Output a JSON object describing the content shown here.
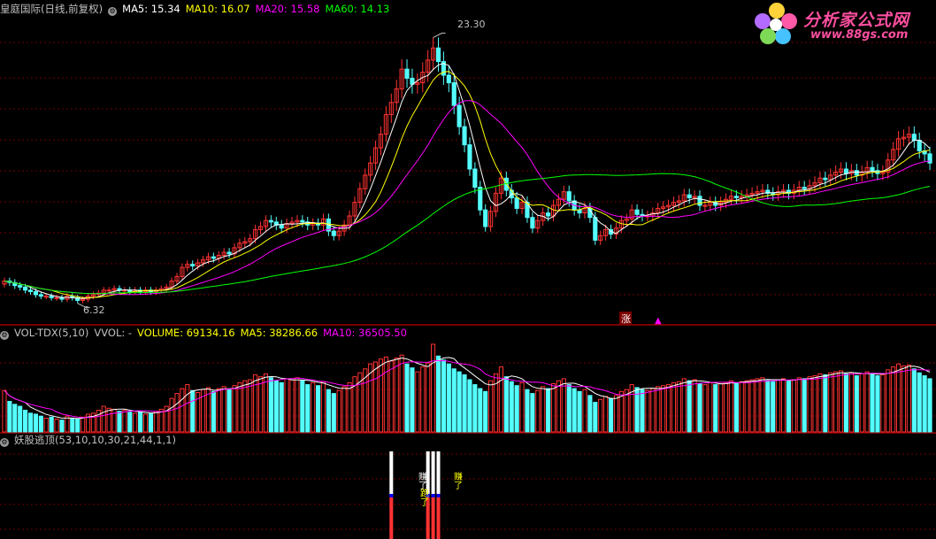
{
  "colors": {
    "up": "#ff3232",
    "down": "#54ffff",
    "ma5": "#ffffff",
    "ma10": "#ffff00",
    "ma20": "#ff00ff",
    "ma60": "#00ff00",
    "grid": "#6b0000",
    "sep": "#a00000",
    "label": "#c0c0c0"
  },
  "price_panel": {
    "title": "皇庭国际(日线,前复权)",
    "ma5_label": "MA5: 15.34",
    "ma10_label": "MA10: 16.07",
    "ma20_label": "MA20: 15.58",
    "ma60_label": "MA60: 14.13",
    "high_label": "23.30",
    "low_label": "6.32",
    "marker_zhang": "涨",
    "gear_icon": "gear-icon"
  },
  "volume_panel": {
    "title": "VOL-TDX(5,10)",
    "vvol_label": "VVOL: -",
    "volume_label": "VOLUME: 69134.16",
    "ma5_label": "MA5: 38286.66",
    "ma10_label": "MA10: 36505.50"
  },
  "signal_panel": {
    "title": "妖股逃顶(53,10,10,30,21,44,1,1)",
    "signal_text": "赚了",
    "signal_text_b": "跑了"
  },
  "logo": {
    "title": "分析家公式网",
    "url": "www.88gs.com"
  },
  "chart_data": [
    {
      "type": "candlestick",
      "title": "皇庭国际(日线,前复权)",
      "annotations": [
        {
          "label": "23.30",
          "kind": "max"
        },
        {
          "label": "6.32",
          "kind": "min"
        }
      ],
      "ylim": [
        5.0,
        25.0
      ],
      "close": [
        7.6,
        7.5,
        7.3,
        7.2,
        7.0,
        6.9,
        6.7,
        6.6,
        6.6,
        6.5,
        6.5,
        6.4,
        6.6,
        6.5,
        6.32,
        6.4,
        6.6,
        6.7,
        6.8,
        7.0,
        7.0,
        7.1,
        7.0,
        7.0,
        6.9,
        7.0,
        6.9,
        7.0,
        6.9,
        7.0,
        7.1,
        7.2,
        7.6,
        7.9,
        8.5,
        8.7,
        8.6,
        8.8,
        9.0,
        9.2,
        9.1,
        9.3,
        9.5,
        9.4,
        9.8,
        10.1,
        10.2,
        10.4,
        11.0,
        11.2,
        11.6,
        11.5,
        11.3,
        11.1,
        11.4,
        11.5,
        11.6,
        11.5,
        11.3,
        11.4,
        11.3,
        11.7,
        10.9,
        10.6,
        10.9,
        11.3,
        11.9,
        12.8,
        13.7,
        14.6,
        15.4,
        16.4,
        17.3,
        18.6,
        19.4,
        20.3,
        21.6,
        21.0,
        20.6,
        20.7,
        21.4,
        22.2,
        23.0,
        22.1,
        21.2,
        20.7,
        19.2,
        17.8,
        16.6,
        15.0,
        13.8,
        12.3,
        11.2,
        12.2,
        13.4,
        14.4,
        13.6,
        13.1,
        12.4,
        12.8,
        11.8,
        11.1,
        11.6,
        12.1,
        11.9,
        12.6,
        13.0,
        13.5,
        12.9,
        12.3,
        12.1,
        12.4,
        11.8,
        10.3,
        10.6,
        11.0,
        10.7,
        11.1,
        11.6,
        11.7,
        12.3,
        12.0,
        11.9,
        11.9,
        12.1,
        12.4,
        12.5,
        12.6,
        12.8,
        12.9,
        13.3,
        13.1,
        13.2,
        12.6,
        12.6,
        12.8,
        12.6,
        12.8,
        13.0,
        13.2,
        13.1,
        13.2,
        13.3,
        13.4,
        13.5,
        13.6,
        13.4,
        13.3,
        13.5,
        13.6,
        13.4,
        13.6,
        13.8,
        13.7,
        13.9,
        14.1,
        14.4,
        14.3,
        14.6,
        14.8,
        15.0,
        14.7,
        14.9,
        14.6,
        14.8,
        15.1,
        14.9,
        14.7,
        14.8,
        15.6,
        16.3,
        17.0,
        17.1,
        17.3,
        16.9,
        16.2,
        16.0,
        15.4
      ],
      "open": [
        7.4,
        7.6,
        7.5,
        7.3,
        7.2,
        7.0,
        6.9,
        6.7,
        6.6,
        6.6,
        6.5,
        6.5,
        6.4,
        6.6,
        6.5,
        6.32,
        6.4,
        6.6,
        6.7,
        6.8,
        7.0,
        7.0,
        7.1,
        7.0,
        7.0,
        6.9,
        7.0,
        6.9,
        7.0,
        6.9,
        7.0,
        7.1,
        7.2,
        7.6,
        7.9,
        8.5,
        8.7,
        8.6,
        8.8,
        9.0,
        9.2,
        9.1,
        9.3,
        9.5,
        9.4,
        9.8,
        10.1,
        10.2,
        10.4,
        11.0,
        11.2,
        11.6,
        11.5,
        11.3,
        11.1,
        11.4,
        11.5,
        11.6,
        11.5,
        11.3,
        11.4,
        11.3,
        11.7,
        10.9,
        10.6,
        10.9,
        11.3,
        11.9,
        12.8,
        13.7,
        14.6,
        15.4,
        16.4,
        17.3,
        18.6,
        19.4,
        20.3,
        21.6,
        21.0,
        20.6,
        20.7,
        21.4,
        22.2,
        23.0,
        22.1,
        21.2,
        20.7,
        19.2,
        17.8,
        16.6,
        15.0,
        13.8,
        12.3,
        11.2,
        12.2,
        13.4,
        14.4,
        13.6,
        13.1,
        12.4,
        12.8,
        11.8,
        11.1,
        11.6,
        12.1,
        11.9,
        12.6,
        13.0,
        13.5,
        12.9,
        12.3,
        12.1,
        12.4,
        11.8,
        10.3,
        10.6,
        11.0,
        10.7,
        11.1,
        11.6,
        11.7,
        12.3,
        12.0,
        11.9,
        11.9,
        12.1,
        12.4,
        12.5,
        12.6,
        12.8,
        12.9,
        13.3,
        13.1,
        13.2,
        12.6,
        12.6,
        12.8,
        12.6,
        12.8,
        13.0,
        13.2,
        13.1,
        13.2,
        13.3,
        13.4,
        13.5,
        13.6,
        13.4,
        13.3,
        13.5,
        13.6,
        13.4,
        13.6,
        13.8,
        13.7,
        13.9,
        14.1,
        14.4,
        14.3,
        14.6,
        14.8,
        15.0,
        14.7,
        14.9,
        14.6,
        14.8,
        15.1,
        14.9,
        14.7,
        14.8,
        15.6,
        16.3,
        17.0,
        17.1,
        17.3,
        16.9,
        16.2,
        16.0
      ]
    },
    {
      "type": "bar",
      "title": "VOL-TDX(5,10)",
      "values": [
        4.2,
        3.1,
        2.8,
        2.6,
        2.2,
        1.9,
        1.8,
        1.6,
        1.4,
        1.5,
        1.3,
        1.2,
        1.6,
        1.4,
        1.3,
        1.5,
        1.8,
        1.9,
        2.2,
        2.6,
        2.4,
        2.3,
        2.1,
        2.2,
        2.0,
        1.9,
        2.0,
        1.8,
        1.9,
        2.1,
        2.3,
        2.6,
        3.4,
        3.9,
        4.4,
        4.8,
        4.2,
        4.0,
        4.3,
        4.5,
        4.1,
        4.4,
        4.6,
        4.3,
        4.7,
        5.0,
        5.2,
        5.3,
        5.8,
        5.6,
        5.9,
        5.5,
        5.2,
        5.0,
        5.4,
        5.3,
        5.5,
        5.2,
        4.8,
        5.0,
        4.7,
        5.1,
        4.3,
        3.9,
        4.2,
        4.6,
        5.0,
        5.6,
        6.0,
        6.4,
        6.9,
        7.1,
        7.4,
        7.6,
        7.2,
        7.5,
        7.8,
        6.9,
        6.5,
        6.1,
        6.6,
        7.0,
        8.9,
        7.7,
        7.3,
        6.9,
        6.4,
        6.1,
        5.8,
        5.3,
        4.8,
        4.4,
        4.1,
        5.2,
        5.9,
        6.6,
        5.6,
        5.1,
        4.7,
        5.0,
        4.3,
        3.9,
        4.2,
        4.6,
        4.4,
        4.9,
        5.2,
        5.4,
        4.8,
        4.4,
        4.1,
        4.3,
        3.7,
        3.0,
        3.3,
        3.6,
        3.4,
        3.7,
        4.1,
        4.3,
        4.8,
        4.5,
        4.3,
        4.2,
        4.4,
        4.6,
        4.7,
        4.8,
        5.0,
        5.1,
        5.4,
        5.2,
        5.3,
        4.9,
        4.8,
        5.0,
        4.8,
        4.9,
        5.0,
        5.2,
        5.0,
        5.1,
        5.2,
        5.3,
        5.4,
        5.5,
        5.2,
        5.1,
        5.3,
        5.4,
        5.2,
        5.3,
        5.5,
        5.4,
        5.6,
        5.7,
        5.9,
        5.8,
        6.0,
        6.1,
        6.2,
        5.9,
        6.0,
        5.7,
        5.9,
        6.1,
        5.9,
        5.7,
        5.8,
        6.3,
        6.6,
        6.9,
        6.7,
        6.8,
        6.4,
        6.0,
        5.7,
        5.4
      ]
    }
  ]
}
